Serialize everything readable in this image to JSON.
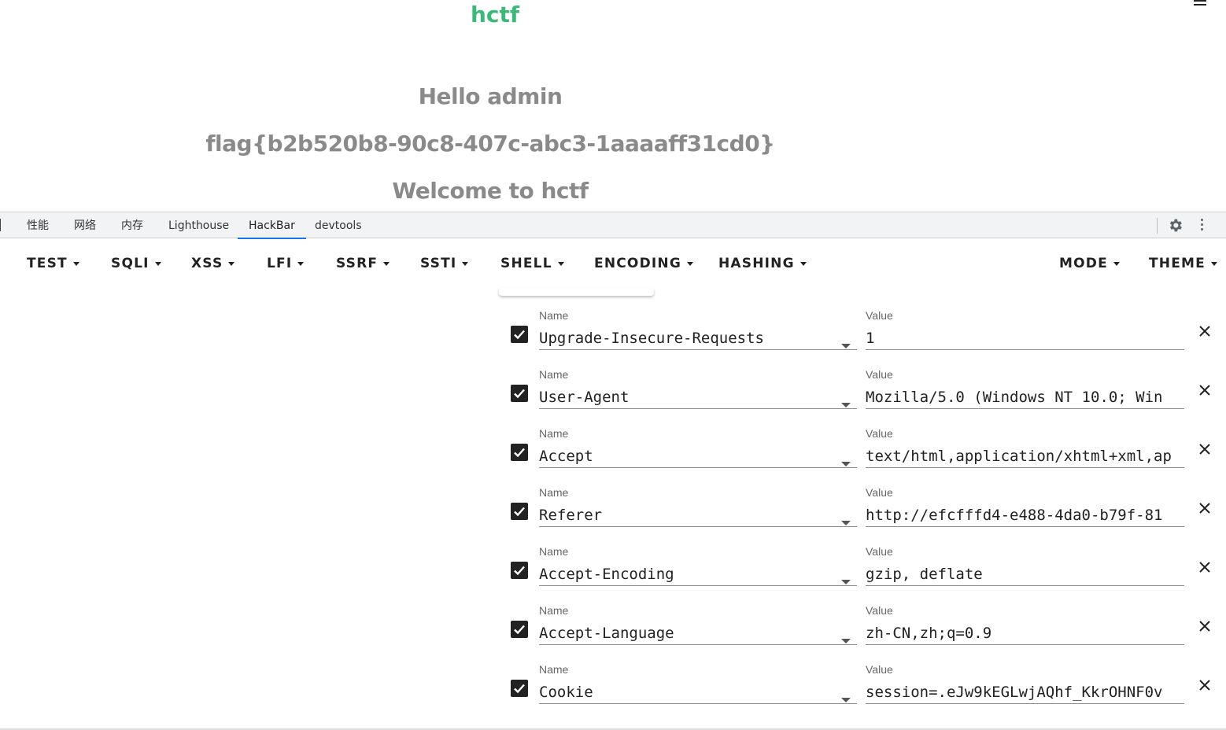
{
  "page": {
    "brand": "hctf",
    "lines": [
      "Hello admin",
      "flag{b2b520b8-90c8-407c-abc3-1aaaaff31cd0}",
      "Welcome to hctf"
    ],
    "menu_icon": "hamburger-menu-icon"
  },
  "devtools": {
    "tabs": [
      "性能",
      "网络",
      "内存",
      "Lighthouse",
      "HackBar",
      "devtools"
    ],
    "active_tab": "HackBar",
    "icons": [
      "settings-gear-icon",
      "more-vert-icon"
    ]
  },
  "hackbar": {
    "menu": [
      "TEST",
      "SQLI",
      "XSS",
      "LFI",
      "SSRF",
      "SSTI",
      "SHELL",
      "ENCODING",
      "HASHING"
    ],
    "right_menu": [
      "MODE",
      "THEME"
    ]
  },
  "headers": {
    "name_label": "Name",
    "value_label": "Value",
    "rows": [
      {
        "name": "Upgrade-Insecure-Requests",
        "value": "1",
        "checked": true
      },
      {
        "name": "User-Agent",
        "value": "Mozilla/5.0 (Windows NT 10.0; Win",
        "checked": true
      },
      {
        "name": "Accept",
        "value": "text/html,application/xhtml+xml,ap",
        "checked": true
      },
      {
        "name": "Referer",
        "value": "http://efcfffd4-e488-4da0-b79f-81",
        "checked": true
      },
      {
        "name": "Accept-Encoding",
        "value": "gzip, deflate",
        "checked": true
      },
      {
        "name": "Accept-Language",
        "value": "zh-CN,zh;q=0.9",
        "checked": true
      },
      {
        "name": "Cookie",
        "value": "session=.eJw9kEGLwjAQhf_KkrOHNF0v",
        "checked": true
      }
    ]
  }
}
